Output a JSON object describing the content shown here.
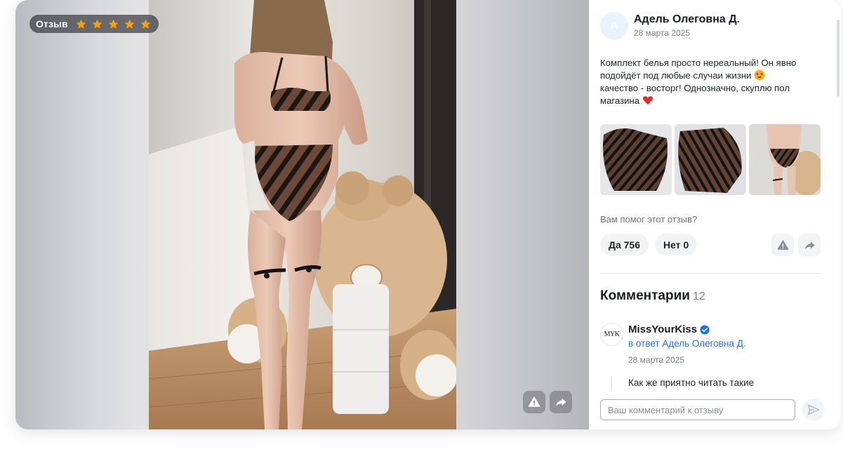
{
  "review": {
    "rating_label": "Отзыв",
    "stars": 5,
    "author_initial": "А",
    "author_name": "Адель Олеговна Д.",
    "date": "28 марта 2025",
    "text_line1": "Комплект белья просто нереальный! Он явно",
    "text_line2": "подойдёт под любые случаи жизни",
    "text_line3": "качество - восторг! Однозначно, скуплю пол",
    "text_line4": "магазина",
    "emoji_star_eyes": "star-struck-emoji",
    "emoji_heart": "red-heart-emoji"
  },
  "helpful": {
    "question": "Вам помог этот отзыв?",
    "yes_label": "Да 756",
    "no_label": "Нет 0"
  },
  "comments": {
    "title": "Комментарии",
    "count": "12",
    "items": [
      {
        "avatar_text": "MYK",
        "author": "MissYourKiss",
        "verified": true,
        "reply_to": "в ответ Адель Олеговна Д.",
        "date": "28 марта 2025",
        "text": "Как же приятно читать такие"
      }
    ]
  },
  "composer": {
    "placeholder": "Ваш комментарий к отзыву"
  },
  "colors": {
    "star": "#f7a100",
    "link": "#2b6fe0",
    "verified": "#1f6fe8"
  },
  "icons": {
    "report": "warning-icon",
    "share": "share-arrow-icon",
    "send": "send-icon"
  }
}
